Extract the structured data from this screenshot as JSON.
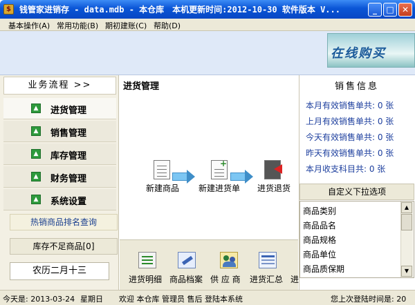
{
  "window": {
    "title": "钱管家进销存 - data.mdb - 本仓库　本机更新时间:2012-10-30 软件版本 V..."
  },
  "menu": [
    {
      "label": "基本操作(A)"
    },
    {
      "label": "常用功能(B)"
    },
    {
      "label": "期初建账(C)"
    },
    {
      "label": "帮助(D)"
    }
  ],
  "banner": {
    "text": "在线购买"
  },
  "left_panel": {
    "header": "业务流程 >>",
    "items": [
      {
        "label": "进货管理",
        "active": true
      },
      {
        "label": "销售管理",
        "active": false
      },
      {
        "label": "库存管理",
        "active": false
      },
      {
        "label": "财务管理",
        "active": false
      },
      {
        "label": "系统设置",
        "active": false
      }
    ],
    "hot_query": "热销商品排名查询",
    "low_stock": "库存不足商品[0]",
    "lunar_date": "农历二月十三"
  },
  "center": {
    "title": "进货管理",
    "flow": [
      {
        "label": "新建商品",
        "icon": "document-icon"
      },
      {
        "label": "新建进货单",
        "icon": "add-document-icon"
      },
      {
        "label": "进货退货",
        "icon": "return-document-icon"
      }
    ],
    "toolbar": [
      {
        "label": "进货明细",
        "icon": "list-icon"
      },
      {
        "label": "商品档案",
        "icon": "tools-icon"
      },
      {
        "label": "供 应 商",
        "icon": "users-icon"
      },
      {
        "label": "进货汇总",
        "icon": "table-icon"
      },
      {
        "label": "进"
      }
    ]
  },
  "right_panel": {
    "sales_title": "销售信息",
    "sales_lines": [
      "本月有效销售单共: 0 张",
      "上月有效销售单共: 0 张",
      "今天有效销售单共: 0 张",
      "昨天有效销售单共: 0 张",
      "本月收支科目共: 0 张"
    ],
    "custom_title": "自定义下拉选项",
    "custom_items": [
      "商品类别",
      "商品品名",
      "商品规格",
      "商品单位",
      "商品质保期"
    ]
  },
  "statusbar": {
    "date": "今天是: 2013-03-24",
    "weekday": "星期日",
    "welcome": "欢迎 本仓库 管理员 售后 登陆本系统",
    "last_login": "您上次登陆时间是: 20"
  },
  "colors": {
    "titlebar": "#0a55d6",
    "nav_arrow": "#2e9a3c",
    "sales_text": "#1d3f9e"
  }
}
